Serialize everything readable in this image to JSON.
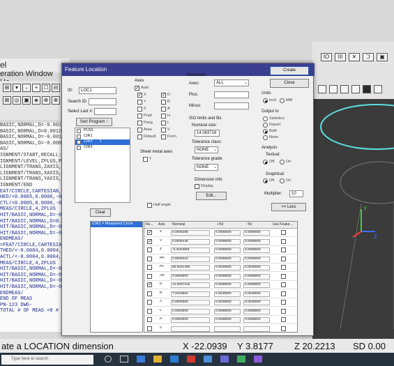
{
  "app": {
    "title": "el",
    "menu": "eration  Window  He",
    "toolbar_glyphs": [
      "⊞",
      "▾",
      "↓",
      "+",
      "☐",
      "⊟",
      "⊠",
      "◎",
      "▣",
      "◈",
      "⊕",
      "⊗"
    ],
    "code_lines": [
      "BASIC,NORMAL,D=-0.001",
      "BASIC,NORMAL,D=0.0012",
      "BASIC,NORMAL,D=-0.001",
      "BASIC,NORMAL,D=-0.0009,",
      "AS/",
      "IGNMENT/START,RECALL:STARTU",
      "IGNMENT/LEVEL,ZPLUS,PLN1",
      "LIGNMENT/TRANS,ZAXIS,PLN1",
      "LIGNMENT/TRANS,XAXIS,CIR1",
      "LIGNMENT/TRANS,YAXIS,CIR1",
      "IGNMENT/END",
      "EAT/CIRCLE,CARTESIAN,OUT,LE",
      "HEO/<0.0005,0.0006,-0.3195",
      "CTL/<0.0005,0.0006,-0.3195",
      "MEAS/CIRCLE,4,ZPLUS",
      "HIT/BASIC,NORMAL,D=-0.0001",
      "HIT/BASIC,NORMAL,D=0.0001",
      "HIT/BASIC,NORMAL,D=-0.0001",
      "HIT/BASIC,NORMAL,D=-0.0001",
      "ENDMEAS/",
      "=FEAT/CIRCLE,CARTESIAN,IN,LEA",
      "THEO/<-0.0004,0.0004,-1.3776",
      "ACTL/<-0.0004,0.0004,-1.3776",
      "MEAS/CIRCLE,4,ZPLUS",
      "HIT/BASIC,NORMAL,D=-0.0011,",
      "HIT/BASIC,NORMAL,D=-0.0012",
      "HIT/BASIC,NORMAL,D=-0.0015,",
      "HIT/BASIC,NORMAL,D=-0.0014",
      "ENDMEAS/",
      "END OF MEAS",
      "PN-123          DWG-",
      "TOTAL # OF MEAS =0      # OUT OF TOL"
    ],
    "status_left": "ate a LOCATION dimension",
    "status_x": "X -22.0939",
    "status_y": "Y 3.8177",
    "status_z": "Z 20.2213",
    "status_sd": "SD 0.00",
    "search_placeholder": "Type here to search",
    "top_icons": [
      "IO",
      "III",
      "✕",
      "Ↄ",
      "▣"
    ],
    "triad": {
      "y": "Y",
      "z": "Z"
    }
  },
  "dialog": {
    "title": "Feature Location",
    "id_label": "ID:",
    "id_value": "LOC1",
    "search_label": "Search ID:",
    "select_last_label": "Select Last #:",
    "sort_program_label": "Sort Program ↑",
    "features": [
      "PLN1",
      "CIR1",
      "CIR2",
      "CIR3"
    ],
    "feature_selected_index": 2,
    "feature_selected_suffix": "1",
    "clear_label": "Clear",
    "measured_caption": "CIR2 = Measured Circle",
    "axes_title": "Axes",
    "auto_label": "Auto",
    "axes_left": [
      "X",
      "Y",
      "Z",
      "Prad",
      "Pang",
      "Area",
      "Default"
    ],
    "axes_right": [
      "D",
      "R",
      "A",
      "H",
      "L",
      "V",
      "Form"
    ],
    "axes_checked": [
      "Auto",
      "X",
      "D"
    ],
    "sheet_metal_label": "Sheet metal axes",
    "sheet_t": "T",
    "half_angle_label": "Half angle",
    "tolerances_title": "Tolerances",
    "tol_axes_label": "Axes:",
    "tol_axes_value": "ALL",
    "plus_label": "Plus:",
    "minus_label": "Minus:",
    "iso_title": "ISO limits and fits",
    "nominal_size_label": "Nominal size:",
    "nominal_size_value": "14.083716",
    "tol_class_label": "Tolerance class:",
    "tol_class_value": "NONE",
    "tol_grade_label": "Tolerance grade:",
    "tol_grade_value": "NONE",
    "dim_info_title": "Dimension info",
    "display_label": "Display",
    "edit_label": "Edit...",
    "create_label": "Create",
    "close_label": "Close",
    "units_title": "Units",
    "units": [
      "Inch",
      "MM"
    ],
    "units_selected": "Inch",
    "output_title": "Output to",
    "outputs": [
      "Statistics",
      "Report",
      "Both",
      "None"
    ],
    "output_selected": "Both",
    "analysis_title": "Analysis",
    "textual_label": "Textual:",
    "graphical_label": "Graphical:",
    "off_label": "Off",
    "on_label": "On",
    "multiplier_label": "Multiplier:",
    "multiplier_value": "10",
    "less_label": "<< Less",
    "grid_headers": [
      "Re...",
      "Axis",
      "Nominal",
      "+Tol",
      "-Tol",
      "Use Featur..."
    ],
    "grid_rows": [
      {
        "axis": "X",
        "nominal": "0.0005298",
        "plus": "0.0098000",
        "minus": "0.0098000",
        "re": true
      },
      {
        "axis": "Y",
        "nominal": "0.0005445",
        "plus": "0.0098000",
        "minus": "0.0098000",
        "re": true
      },
      {
        "axis": "Z",
        "nominal": "-0.3194898",
        "plus": "0.0098000",
        "minus": "0.0098000",
        "re": false
      },
      {
        "axis": "PR",
        "nominal": "0.0008322",
        "plus": "0.0098000",
        "minus": "0.0098000",
        "re": false
      },
      {
        "axis": "PA",
        "nominal": "50.8241466",
        "plus": "0.0039000",
        "minus": "0.0039000",
        "re": false
      },
      {
        "axis": "AR",
        "nominal": "0.0000000",
        "plus": "0.0098000",
        "minus": "0.0098000",
        "re": false
      },
      {
        "axis": "D",
        "nominal": "14.0837162",
        "plus": "0.0098000",
        "minus": "0.0098000",
        "re": true
      },
      {
        "axis": "R",
        "nominal": "7.0418581",
        "plus": "0.0049000",
        "minus": "0.0049000",
        "re": false
      },
      {
        "axis": "A",
        "nominal": "0.0000000",
        "plus": "0.0039000",
        "minus": "0.0039000",
        "re": false
      },
      {
        "axis": "L",
        "nominal": "0.0000000",
        "plus": "0.0098000",
        "minus": "0.0098000",
        "re": false
      },
      {
        "axis": "H",
        "nominal": "0.0000000",
        "plus": "0.0098000",
        "minus": "0.0098000",
        "re": false
      },
      {
        "axis": "V",
        "nominal": "",
        "plus": "",
        "minus": "",
        "re": false
      }
    ]
  },
  "colors": {
    "dialog_title": "#3b3f8f",
    "selection": "#2f6fd6",
    "view_bg": "#3b3b3b",
    "taskbar": "#27323f"
  }
}
